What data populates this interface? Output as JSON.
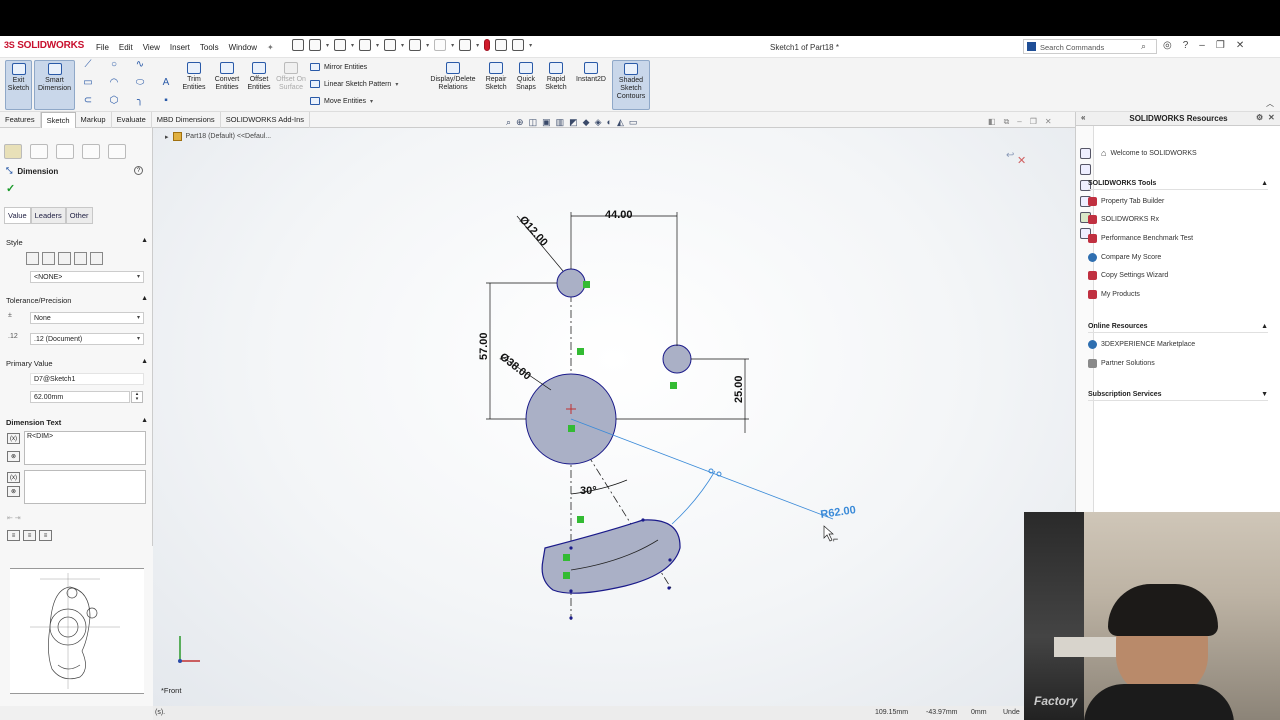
{
  "app": {
    "brand": "SOLIDWORKS",
    "brand_prefix": "3S",
    "doc_title": "Sketch1 of Part18 *"
  },
  "menu": [
    "File",
    "Edit",
    "View",
    "Insert",
    "Tools",
    "Window"
  ],
  "search": {
    "placeholder": "Search Commands"
  },
  "ribbon": {
    "exit_sketch": "Exit Sketch",
    "smart_dimension": "Smart Dimension",
    "trim": "Trim Entities",
    "convert": "Convert Entities",
    "offset": "Offset Entities",
    "offset_surface": "Offset On Surface",
    "mirror": "Mirror Entities",
    "linear_pattern": "Linear Sketch Pattern",
    "move": "Move Entities",
    "display_delete": "Display/Delete Relations",
    "repair": "Repair Sketch",
    "quick_snaps": "Quick Snaps",
    "rapid_sketch": "Rapid Sketch",
    "instant2d": "Instant2D",
    "shaded_contours": "Shaded Sketch Contours"
  },
  "tabs": [
    "Features",
    "Sketch",
    "Markup",
    "Evaluate",
    "MBD Dimensions",
    "SOLIDWORKS Add-Ins"
  ],
  "active_tab": "Sketch",
  "tree": {
    "label": "Part18 (Default) <<Defaul..."
  },
  "pm": {
    "title": "Dimension",
    "subtabs": [
      "Value",
      "Leaders",
      "Other"
    ],
    "style_label": "Style",
    "style_value": "<NONE>",
    "tolerance_label": "Tolerance/Precision",
    "tolerance_value": "None",
    "precision_value": ".12 (Document)",
    "primary_label": "Primary Value",
    "primary_name": "D7@Sketch1",
    "primary_value": "62.00mm",
    "dimtext_label": "Dimension Text",
    "dimtext_value": "R<DIM>"
  },
  "drawing": {
    "dims": {
      "d12": "Ø12.00",
      "d44": "44.00",
      "d57": "57.00",
      "d38": "Ø38.00",
      "d25": "25.00",
      "a30": "30°",
      "r62": "R62.00"
    },
    "view_label": "*Front"
  },
  "status": {
    "hint": "(s).",
    "x": "109.15mm",
    "y": "-43.97mm",
    "z": "0mm",
    "state": "Unde"
  },
  "right_pane": {
    "title": "SOLIDWORKS Resources",
    "welcome": "Welcome to SOLIDWORKS",
    "tools_header": "SOLIDWORKS Tools",
    "tools": [
      "Property Tab Builder",
      "SOLIDWORKS Rx",
      "Performance Benchmark Test",
      "Compare My Score",
      "Copy Settings Wizard",
      "My Products"
    ],
    "online_header": "Online Resources",
    "online": [
      "3DEXPERIENCE Marketplace",
      "Partner Solutions"
    ],
    "subscription_header": "Subscription Services"
  },
  "webcam": {
    "watermark": "Factory"
  },
  "colors": {
    "accent": "#1f4e96",
    "brand": "#c8102e",
    "sketch_fill": "#a9aec8",
    "sketch_line": "#1a1a9a",
    "preview_dim": "#3a8ad8"
  }
}
